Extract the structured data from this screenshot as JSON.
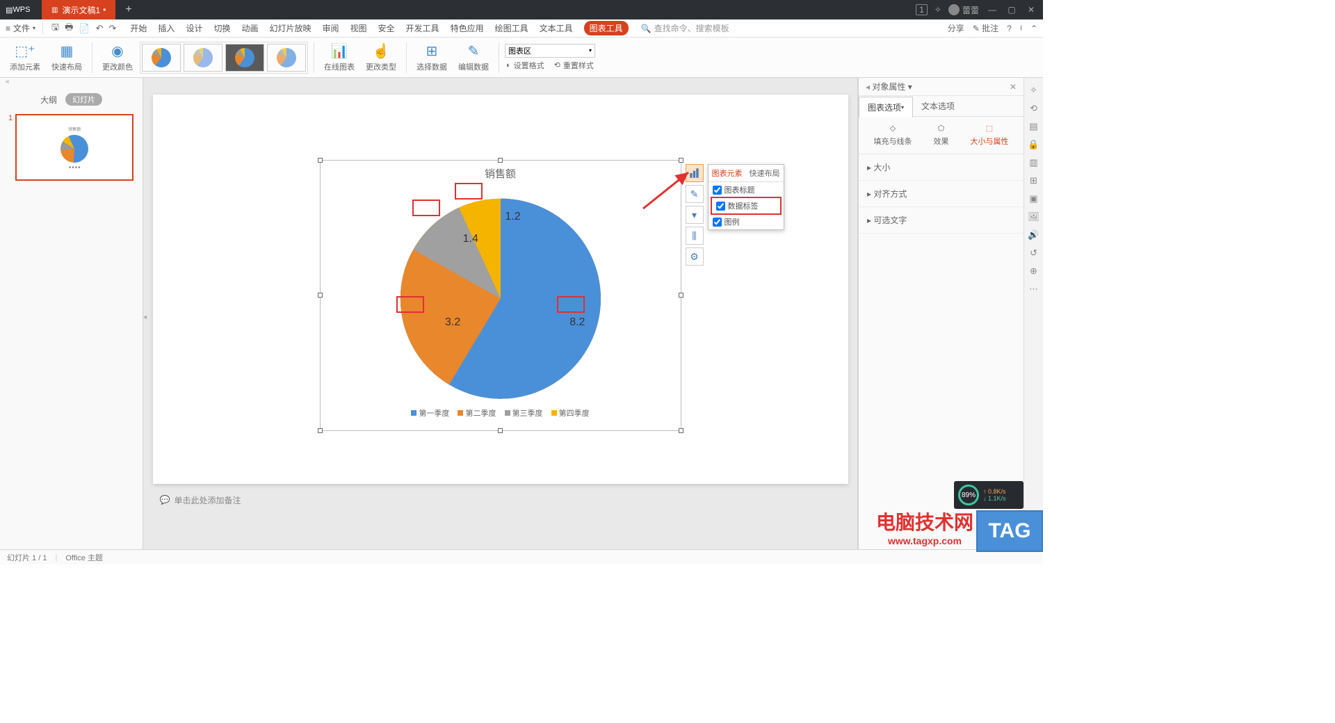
{
  "title_bar": {
    "app": "WPS",
    "doc_tab": "演示文稿1",
    "user": "蕾蕾",
    "badge_count": "1"
  },
  "menu": {
    "file": "文件",
    "tabs": [
      "开始",
      "插入",
      "设计",
      "切换",
      "动画",
      "幻灯片放映",
      "审阅",
      "视图",
      "安全",
      "开发工具",
      "特色应用",
      "绘图工具",
      "文本工具",
      "图表工具"
    ],
    "search_placeholder": "查找命令、搜索模板",
    "share": "分享",
    "comment": "批注"
  },
  "ribbon": {
    "add_element": "添加元素",
    "quick_layout": "快速布局",
    "change_color": "更改颜色",
    "online_chart": "在线图表",
    "change_type": "更改类型",
    "select_data": "选择数据",
    "edit_data": "编辑数据",
    "area_select": "图表区",
    "set_format": "设置格式",
    "reset_style": "重置样式"
  },
  "slide_panel": {
    "outline": "大纲",
    "slides": "幻灯片",
    "slide_num": "1"
  },
  "notes_placeholder": "单击此处添加备注",
  "chart_data": {
    "type": "pie",
    "title": "销售额",
    "categories": [
      "第一季度",
      "第二季度",
      "第三季度",
      "第四季度"
    ],
    "values": [
      8.2,
      3.2,
      1.4,
      1.2
    ],
    "colors": [
      "#4a90d9",
      "#e8872b",
      "#a0a0a0",
      "#f5b400"
    ]
  },
  "float_popup": {
    "tab_elements": "图表元素",
    "tab_layout": "快速布局",
    "opts": {
      "title": "图表标题",
      "labels": "数据标签",
      "legend": "图例"
    }
  },
  "props": {
    "header": "对象属性",
    "tab_chart": "图表选项",
    "tab_text": "文本选项",
    "fill_line": "填充与线条",
    "effect": "效果",
    "size_prop": "大小与属性",
    "sec_size": "大小",
    "sec_align": "对齐方式",
    "sec_optional": "可选文字"
  },
  "status": {
    "slide_info": "幻灯片 1 / 1",
    "theme": "Office 主题"
  },
  "net": {
    "pct": "89%",
    "up": "0.8K/s",
    "down": "1.1K/s"
  },
  "watermark": {
    "line1": "电脑技术网",
    "line2": "www.tagxp.com",
    "tag": "TAG"
  }
}
